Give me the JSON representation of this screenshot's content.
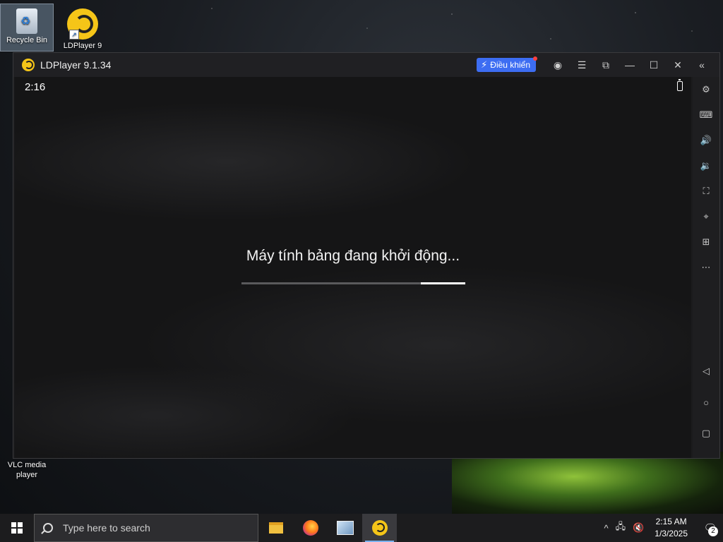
{
  "desktop": {
    "icons": [
      {
        "label": "Recycle Bin"
      },
      {
        "label": "LDPlayer 9"
      }
    ],
    "bottom_icon_label": "VLC media player"
  },
  "window": {
    "title": "LDPlayer 9.1.34",
    "control_button_label": "Điều khiển",
    "accent_color": "#3d6df2"
  },
  "android": {
    "clock": "2:16",
    "boot_message": "Máy tính bảng đang khởi động...",
    "progress_percent": 20
  },
  "sidebar_icons": [
    "settings-icon",
    "keyboard-icon",
    "volume-up-icon",
    "volume-down-icon",
    "screenshot-icon",
    "virtual-location-icon",
    "add-window-icon",
    "more-icon",
    "back-icon",
    "home-icon",
    "recents-icon"
  ],
  "taskbar": {
    "search_placeholder": "Type here to search",
    "time": "2:15 AM",
    "date": "1/3/2025",
    "notification_count": "2"
  }
}
